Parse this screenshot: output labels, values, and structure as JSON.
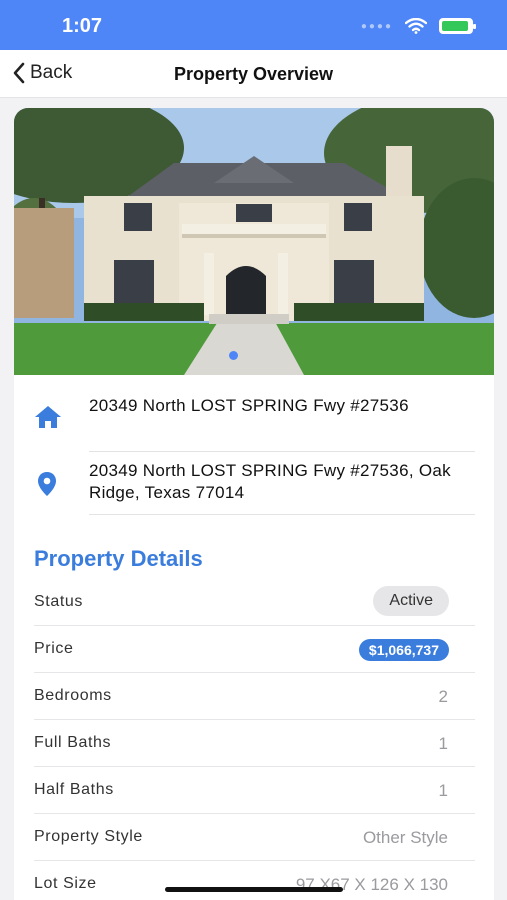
{
  "status_bar": {
    "time": "1:07"
  },
  "nav": {
    "back_label": "Back",
    "title": "Property Overview"
  },
  "gallery": {
    "page_count": 1,
    "current_page": 1
  },
  "address": {
    "line1": "20349 North LOST SPRING Fwy #27536",
    "line2": "20349 North LOST SPRING Fwy #27536, Oak Ridge, Texas 77014",
    "home_icon": "house-icon",
    "pin_icon": "location-pin-icon"
  },
  "details": {
    "section_title": "Property Details",
    "status_label": "Status",
    "status_value": "Active",
    "price_label": "Price",
    "price_value": "$1,066,737",
    "bedrooms_label": "Bedrooms",
    "bedrooms_value": "2",
    "full_baths_label": "Full Baths",
    "full_baths_value": "1",
    "half_baths_label": "Half Baths",
    "half_baths_value": "1",
    "style_label": "Property Style",
    "style_value": "Other Style",
    "lot_label": "Lot Size",
    "lot_value": "97 X67 X 126 X 130"
  },
  "colors": {
    "accent": "#3b7ddd",
    "status_bar": "#4f86f7"
  }
}
